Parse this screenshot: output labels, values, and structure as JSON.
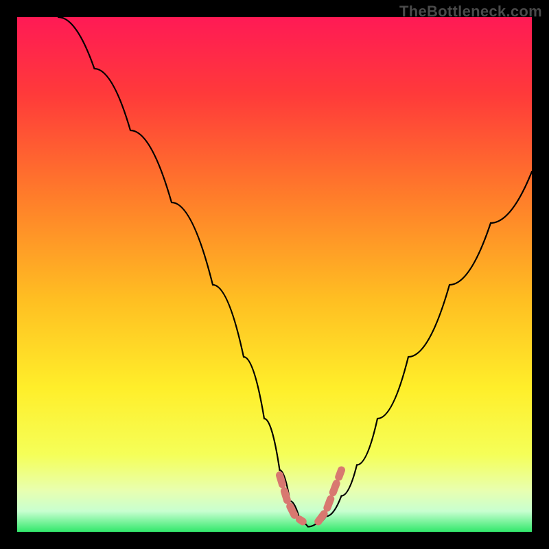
{
  "watermark": "TheBottleneck.com",
  "colors": {
    "frame": "#000000",
    "watermark": "#4a4a4a",
    "curve": "#000000",
    "marker": "#d87870",
    "gradient_stops": [
      {
        "offset": 0.0,
        "color": "#ff1a55"
      },
      {
        "offset": 0.15,
        "color": "#ff3a3a"
      },
      {
        "offset": 0.35,
        "color": "#ff7d2a"
      },
      {
        "offset": 0.55,
        "color": "#ffbf22"
      },
      {
        "offset": 0.72,
        "color": "#ffee2a"
      },
      {
        "offset": 0.85,
        "color": "#f5ff58"
      },
      {
        "offset": 0.92,
        "color": "#e8ffb0"
      },
      {
        "offset": 0.96,
        "color": "#c8ffd0"
      },
      {
        "offset": 1.0,
        "color": "#32e86b"
      }
    ]
  },
  "chart_data": {
    "type": "line",
    "title": "",
    "xlabel": "",
    "ylabel": "",
    "xlim": [
      0,
      100
    ],
    "ylim": [
      0,
      100
    ],
    "grid": false,
    "series": [
      {
        "name": "bottleneck-curve",
        "x": [
          8,
          15,
          22,
          30,
          38,
          44,
          48,
          51,
          53,
          55,
          56.5,
          58,
          60,
          63,
          66,
          70,
          76,
          84,
          92,
          100
        ],
        "y": [
          100,
          90,
          78,
          64,
          48,
          34,
          22,
          12,
          6,
          2,
          1,
          1.5,
          3,
          7,
          13,
          22,
          34,
          48,
          60,
          70
        ]
      }
    ],
    "markers": [
      {
        "name": "left-hook",
        "x": [
          51,
          52.5,
          54,
          55.5
        ],
        "y": [
          11,
          6,
          3,
          2
        ]
      },
      {
        "name": "right-hook",
        "x": [
          58.5,
          60,
          61.5,
          63
        ],
        "y": [
          2,
          4,
          8,
          12
        ]
      }
    ],
    "description": "V-shaped bottleneck curve over a vertical heat gradient (red at top = high bottleneck, green at bottom = low). The minimum of the curve sits near x≈57 at the green band. Short salmon-colored dashed hooks mark the near-bottom region on both sides of the minimum."
  }
}
